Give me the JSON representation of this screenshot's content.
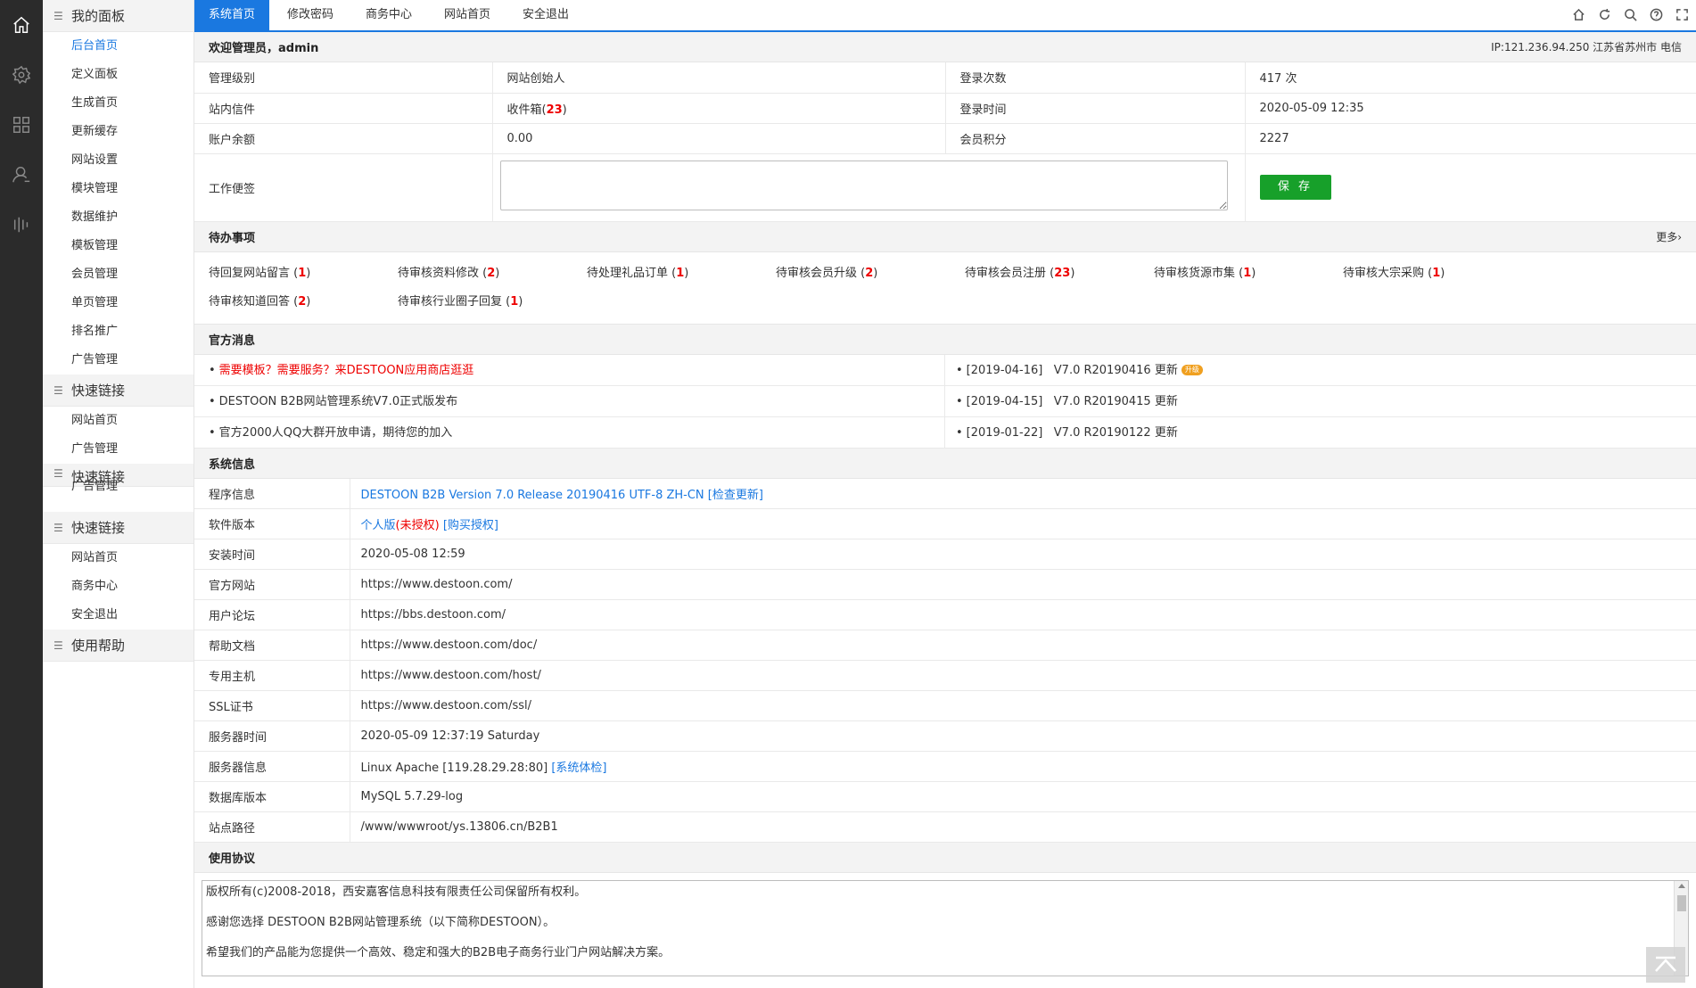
{
  "rail": {
    "icons": [
      "home-icon",
      "gear-icon",
      "grid-icon",
      "user-icon",
      "bars-icon"
    ]
  },
  "sidebar": {
    "groups": [
      {
        "title": "我的面板",
        "items": [
          "后台首页",
          "定义面板",
          "生成首页",
          "更新缓存",
          "网站设置",
          "模块管理",
          "数据维护",
          "模板管理",
          "会员管理",
          "单页管理",
          "排名推广",
          "广告管理"
        ]
      },
      {
        "title": "快速链接",
        "items": [
          "网站首页",
          "广告管理"
        ]
      },
      {
        "title": "快速链接",
        "items": [
          "广告管理"
        ]
      },
      {
        "title": "快速链接",
        "items": [
          "网站首页",
          "商务中心",
          "安全退出"
        ]
      },
      {
        "title": "使用帮助",
        "items": []
      }
    ],
    "active_item": "后台首页"
  },
  "topnav": {
    "tabs": [
      "系统首页",
      "修改密码",
      "商务中心",
      "网站首页",
      "安全退出"
    ],
    "active": "系统首页",
    "icons": [
      "home-icon",
      "refresh-icon",
      "search-icon",
      "help-icon",
      "fullscreen-icon"
    ]
  },
  "welcome": {
    "title": "欢迎管理员，admin",
    "ip": "IP:121.236.94.250 江苏省苏州市 电信"
  },
  "account": {
    "level_label": "管理级别",
    "level_value": "网站创始人",
    "login_count_label": "登录次数",
    "login_count_value": "417 次",
    "msg_label": "站内信件",
    "msg_value_prefix": "收件箱(",
    "msg_count": "23",
    "msg_value_suffix": ")",
    "login_time_label": "登录时间",
    "login_time_value": "2020-05-09 12:35",
    "balance_label": "账户余额",
    "balance_value": "0.00",
    "points_label": "会员积分",
    "points_value": "2227",
    "memo_label": "工作便签",
    "memo_value": "",
    "save_label": "保 存"
  },
  "todo": {
    "title": "待办事项",
    "more": "更多›",
    "items": [
      {
        "label": "待回复网站留言",
        "count": "1"
      },
      {
        "label": "待审核资料修改",
        "count": "2"
      },
      {
        "label": "待处理礼品订单",
        "count": "1"
      },
      {
        "label": "待审核会员升级",
        "count": "2"
      },
      {
        "label": "待审核会员注册",
        "count": "23"
      },
      {
        "label": "待审核货源市集",
        "count": "1"
      },
      {
        "label": "待审核大宗采购",
        "count": "1"
      },
      {
        "label": "待审核知道回答",
        "count": "2"
      },
      {
        "label": "待审核行业圈子回复",
        "count": "1"
      }
    ]
  },
  "news": {
    "title": "官方消息",
    "left": [
      {
        "text": "需要模板？需要服务？来DESTOON应用商店逛逛",
        "highlight": true
      },
      {
        "text": "DESTOON B2B网站管理系统V7.0正式版发布",
        "highlight": false
      },
      {
        "text": "官方2000人QQ大群开放申请，期待您的加入",
        "highlight": false
      }
    ],
    "right": [
      {
        "date": "[2019-04-16]",
        "text": "V7.0 R20190416 更新",
        "badge": "升级"
      },
      {
        "date": "[2019-04-15]",
        "text": "V7.0 R20190415 更新",
        "badge": ""
      },
      {
        "date": "[2019-01-22]",
        "text": "V7.0 R20190122 更新",
        "badge": ""
      }
    ]
  },
  "sysinfo": {
    "title": "系统信息",
    "rows": [
      {
        "label": "程序信息",
        "value": "DESTOON B2B Version 7.0 Release 20190416 UTF-8 ZH-CN",
        "extra": "[检查更新]",
        "style": "link"
      },
      {
        "label": "软件版本",
        "value": "个人版",
        "extra": "(未授权)",
        "extra2": "[购买授权]",
        "style": "license"
      },
      {
        "label": "安装时间",
        "value": "2020-05-08 12:59"
      },
      {
        "label": "官方网站",
        "value": "https://www.destoon.com/"
      },
      {
        "label": "用户论坛",
        "value": "https://bbs.destoon.com/"
      },
      {
        "label": "帮助文档",
        "value": "https://www.destoon.com/doc/"
      },
      {
        "label": "专用主机",
        "value": "https://www.destoon.com/host/"
      },
      {
        "label": "SSL证书",
        "value": "https://www.destoon.com/ssl/"
      },
      {
        "label": "服务器时间",
        "value": "2020-05-09 12:37:19 Saturday"
      },
      {
        "label": "服务器信息",
        "value": "Linux Apache [119.28.29.28:80]",
        "extra": "[系统体检]",
        "style": "check"
      },
      {
        "label": "数据库版本",
        "value": "MySQL 5.7.29-log"
      },
      {
        "label": "站点路径",
        "value": "/www/wwwroot/ys.13806.cn/B2B1"
      }
    ]
  },
  "agreement": {
    "title": "使用协议",
    "lines": [
      "版权所有(c)2008-2018，西安嘉客信息科技有限责任公司保留所有权利。",
      "感谢您选择 DESTOON B2B网站管理系统（以下简称DESTOON）。",
      "希望我们的产品能为您提供一个高效、稳定和强大的B2B电子商务行业门户网站解决方案。"
    ]
  }
}
